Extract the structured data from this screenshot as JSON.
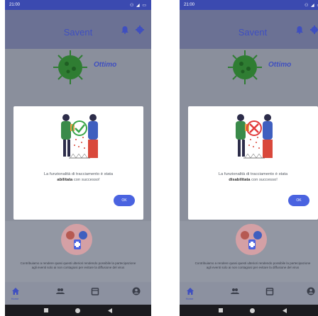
{
  "screens": [
    {
      "status_time": "21:00",
      "status_right": "⚇ ◢ ▭",
      "title": "Savent",
      "status_label": "Ottimo",
      "dialog_text": "La funzionalità di tracciamento è stata",
      "dialog_bold": "abilitata",
      "dialog_suffix": " con successo!",
      "ok_label": "OK",
      "bg_text": "Contribuiamo a rendere quasi questi ulteriori rendendo possibile la partecipazione agli eventi solo ai non contagiosi per evitare la diffusione del virus",
      "nav_label": "Home",
      "illus_state": "check"
    },
    {
      "status_time": "21:00",
      "status_right": "⚇ ◢ ▭",
      "title": "Savent",
      "status_label": "Ottimo",
      "dialog_text": "La funzionalità di tracciamento è stata",
      "dialog_bold": "disabilitata",
      "dialog_suffix": " con successo!",
      "ok_label": "OK",
      "bg_text": "Contribuiamo a rendere quasi questi ulteriori rendendo possibile la partecipazione agli eventi solo ai non contagiosi per evitare la diffusione del virus",
      "nav_label": "Home",
      "illus_state": "cross"
    }
  ],
  "colors": {
    "accent": "#3f4fc0",
    "button": "#4a63e0",
    "virus": "#2f7d32",
    "check": "#3aa54a",
    "cross": "#e23a3a"
  }
}
